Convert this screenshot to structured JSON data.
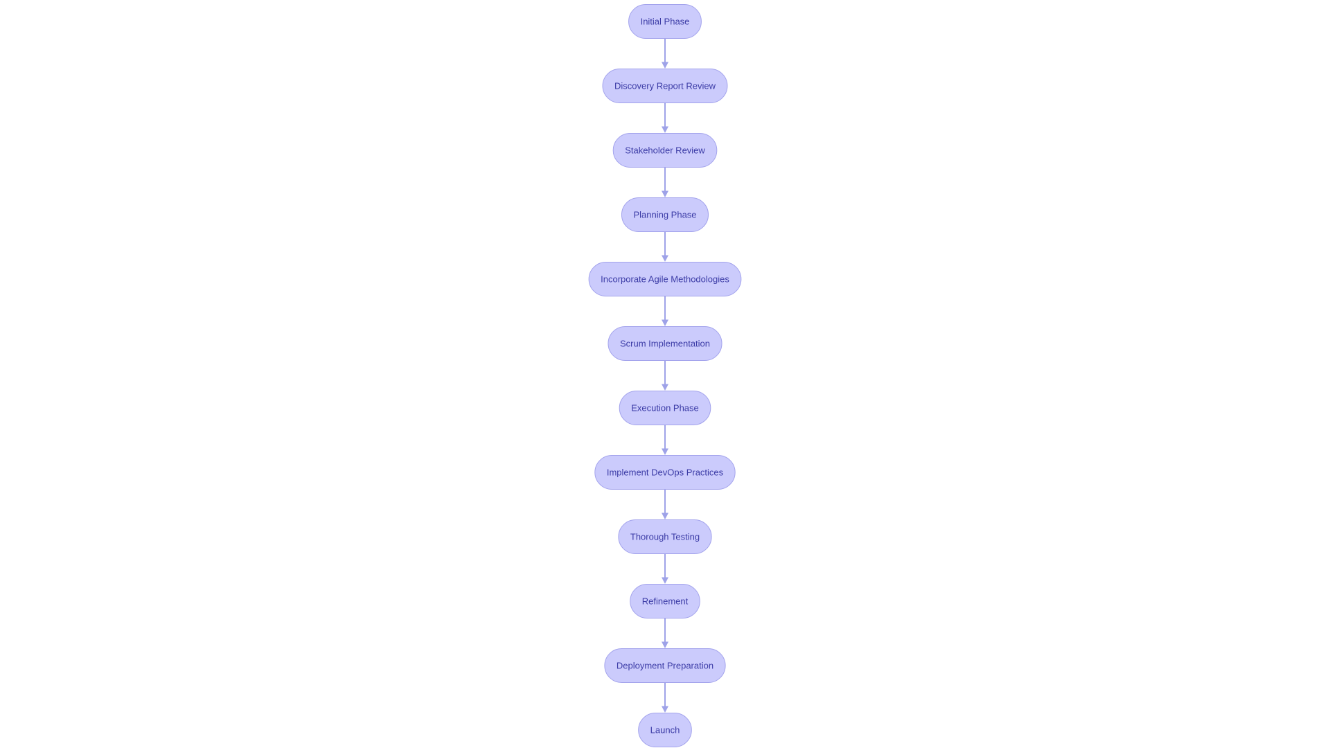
{
  "diagram": {
    "type": "flowchart",
    "direction": "top-to-bottom",
    "colors": {
      "node_fill": "#cbcbfc",
      "node_border": "#a3a3ec",
      "node_text": "#3b3ba6",
      "edge": "#9ea2e8"
    },
    "nodes": [
      {
        "id": "n1",
        "label": "Initial Phase"
      },
      {
        "id": "n2",
        "label": "Discovery Report Review"
      },
      {
        "id": "n3",
        "label": "Stakeholder Review"
      },
      {
        "id": "n4",
        "label": "Planning Phase"
      },
      {
        "id": "n5",
        "label": "Incorporate Agile Methodologies"
      },
      {
        "id": "n6",
        "label": "Scrum Implementation"
      },
      {
        "id": "n7",
        "label": "Execution Phase"
      },
      {
        "id": "n8",
        "label": "Implement DevOps Practices"
      },
      {
        "id": "n9",
        "label": "Thorough Testing"
      },
      {
        "id": "n10",
        "label": "Refinement"
      },
      {
        "id": "n11",
        "label": "Deployment Preparation"
      },
      {
        "id": "n12",
        "label": "Launch"
      }
    ],
    "edges": [
      {
        "from": "n1",
        "to": "n2"
      },
      {
        "from": "n2",
        "to": "n3"
      },
      {
        "from": "n3",
        "to": "n4"
      },
      {
        "from": "n4",
        "to": "n5"
      },
      {
        "from": "n5",
        "to": "n6"
      },
      {
        "from": "n6",
        "to": "n7"
      },
      {
        "from": "n7",
        "to": "n8"
      },
      {
        "from": "n8",
        "to": "n9"
      },
      {
        "from": "n9",
        "to": "n10"
      },
      {
        "from": "n10",
        "to": "n11"
      },
      {
        "from": "n11",
        "to": "n12"
      }
    ]
  }
}
